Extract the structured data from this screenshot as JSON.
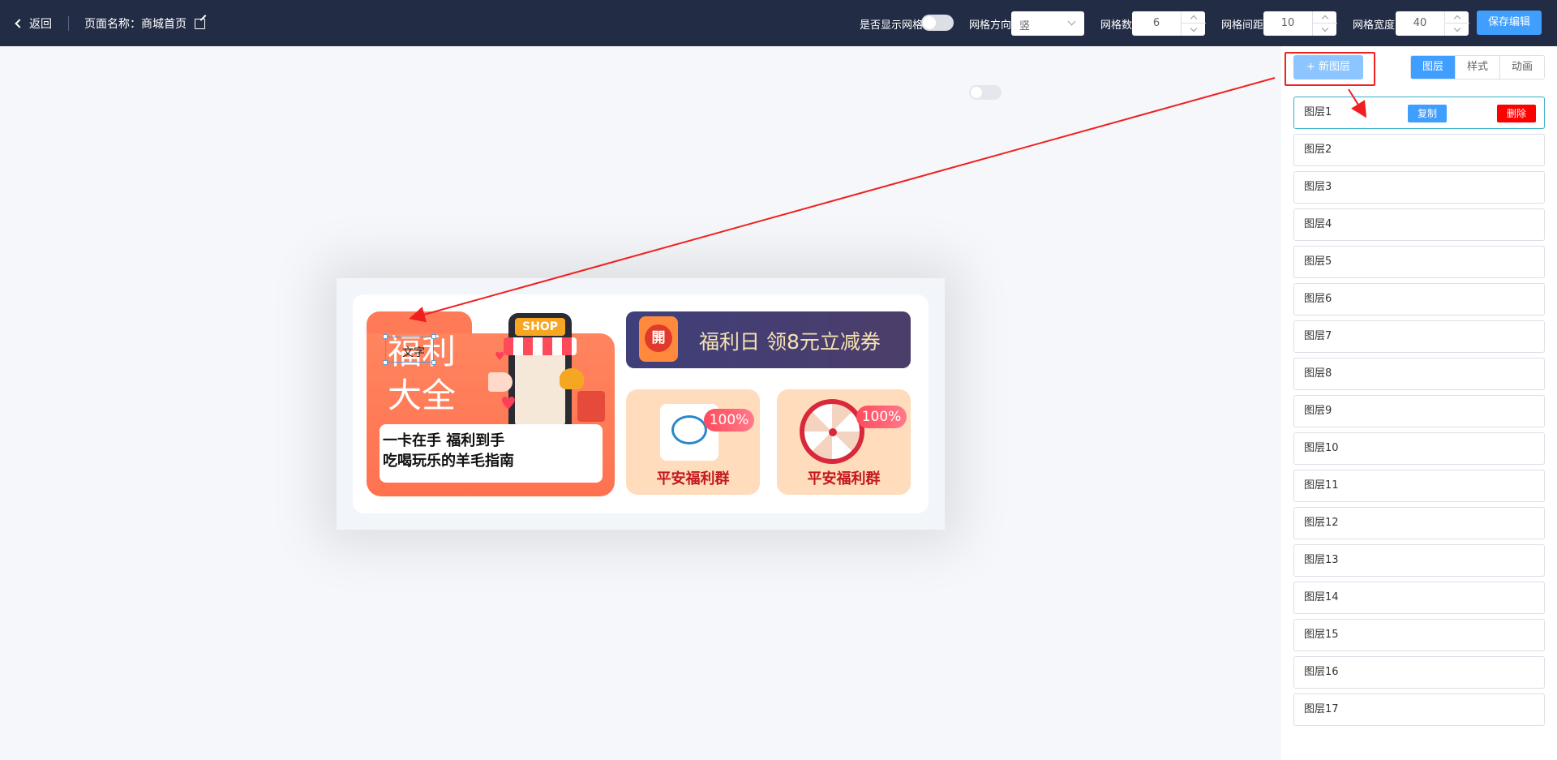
{
  "topbar": {
    "back_label": "返回",
    "page_name": "页面名称：商城首页",
    "show_grid_label": "是否显示网格",
    "direction_label": "网格方向",
    "direction_value": "竖",
    "grid_count_label": "网格数",
    "grid_count_value": "6",
    "grid_gap_label": "网格间距",
    "grid_gap_value": "10",
    "grid_width_label": "网格宽度",
    "grid_width_value": "40",
    "save_label": "保存编辑"
  },
  "canvas": {
    "text_layer_label": "文字",
    "promo_title_1": "福利",
    "promo_title_2": "大全",
    "promo_sub_1": "一卡在手 福利到手",
    "promo_sub_2": "吃喝玩乐的羊毛指南",
    "shop_sign": "SHOP",
    "banner_badge": "開",
    "banner_text": "福利日 领8元立减券",
    "tiles": [
      {
        "percent": "100%",
        "name": "平安福利群"
      },
      {
        "percent": "100%",
        "name": "平安福利群"
      }
    ]
  },
  "panel": {
    "new_layer_label": "+ 新图层",
    "tabs": [
      {
        "label": "图层",
        "active": true
      },
      {
        "label": "样式",
        "active": false
      },
      {
        "label": "动画",
        "active": false
      }
    ],
    "copy_label": "复制",
    "delete_label": "删除",
    "layers": [
      "图层1",
      "图层2",
      "图层3",
      "图层4",
      "图层5",
      "图层6",
      "图层7",
      "图层8",
      "图层9",
      "图层10",
      "图层11",
      "图层12",
      "图层13",
      "图层14",
      "图层15",
      "图层16",
      "图层17"
    ]
  },
  "colors": {
    "topbar_bg": "#232c45",
    "primary": "#409eff",
    "danger": "#ff0000",
    "annotation_red": "#f02020"
  }
}
